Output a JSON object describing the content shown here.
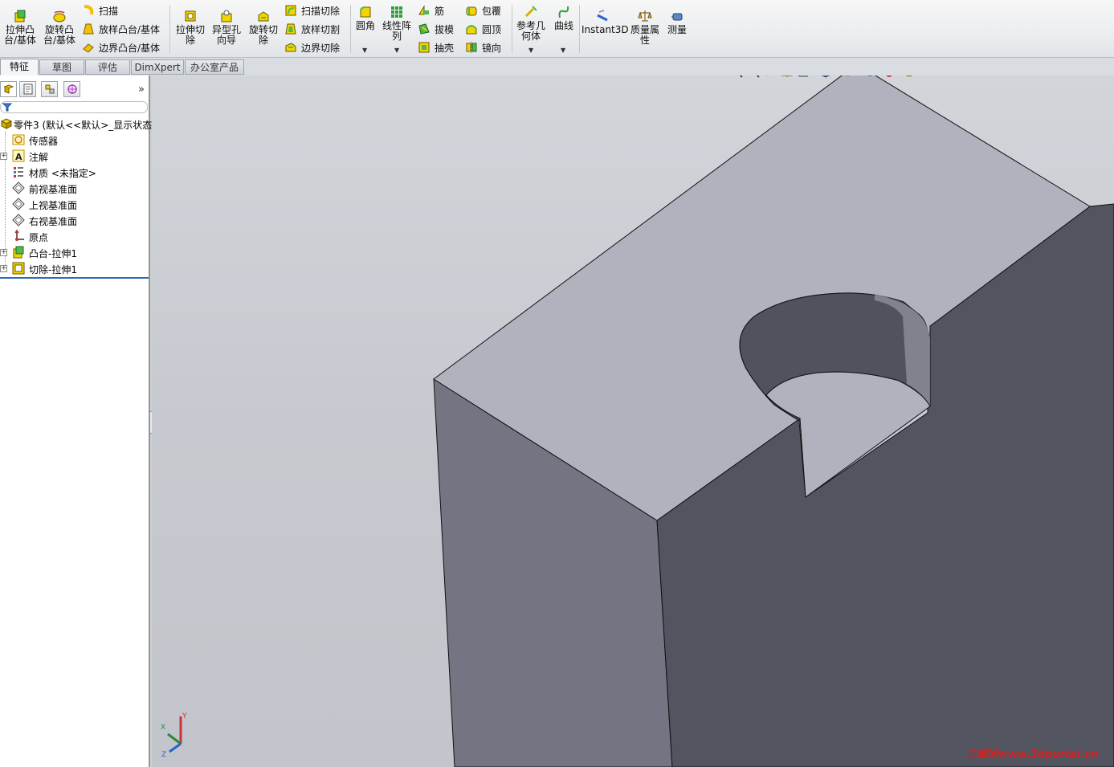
{
  "ribbon": {
    "extrude_boss": "拉伸凸\n台/基体",
    "revolve_boss": "旋转凸\n台/基体",
    "sweep": "扫描",
    "loft_boss": "放样凸台/基体",
    "boundary_boss": "边界凸台/基体",
    "extrude_cut": "拉伸切\n除",
    "hole_wizard": "异型孔\n向导",
    "revolve_cut": "旋转切\n除",
    "sweep_cut": "扫描切除",
    "loft_cut": "放样切割",
    "boundary_cut": "边界切除",
    "fillet": "圆角",
    "linear_pattern": "线性阵\n列",
    "rib": "筋",
    "draft": "拔模",
    "shell": "抽壳",
    "wrap": "包覆",
    "dome": "圆顶",
    "mirror": "镜向",
    "ref_geometry": "参考几\n何体",
    "curves": "曲线",
    "instant3d": "Instant3D",
    "mass_props": "质量属\n性",
    "measure": "测量"
  },
  "tabs": [
    "特征",
    "草图",
    "评估",
    "DimXpert",
    "办公室产品"
  ],
  "tree": {
    "root": "零件3  (默认<<默认>_显示状态",
    "items": [
      {
        "label": "传感器",
        "icon": "sensor-icon",
        "expandable": false
      },
      {
        "label": "注解",
        "icon": "annotation-icon",
        "expandable": true
      },
      {
        "label": "材质 <未指定>",
        "icon": "material-icon",
        "expandable": false
      },
      {
        "label": "前视基准面",
        "icon": "plane-icon",
        "expandable": false
      },
      {
        "label": "上视基准面",
        "icon": "plane-icon",
        "expandable": false
      },
      {
        "label": "右视基准面",
        "icon": "plane-icon",
        "expandable": false
      },
      {
        "label": "原点",
        "icon": "origin-icon",
        "expandable": false
      },
      {
        "label": "凸台-拉伸1",
        "icon": "boss-extrude-icon",
        "expandable": true
      },
      {
        "label": "切除-拉伸1",
        "icon": "cut-extrude-icon",
        "expandable": true
      }
    ]
  },
  "triad": {
    "x": "X",
    "y": "Y",
    "z": "Z"
  },
  "watermark": "三维网www.3dportal.cn",
  "colors": {
    "top_face": "#b0b3bd",
    "front_face": "#737682",
    "side_face": "#52545f",
    "accent": "#2d6ab8"
  }
}
